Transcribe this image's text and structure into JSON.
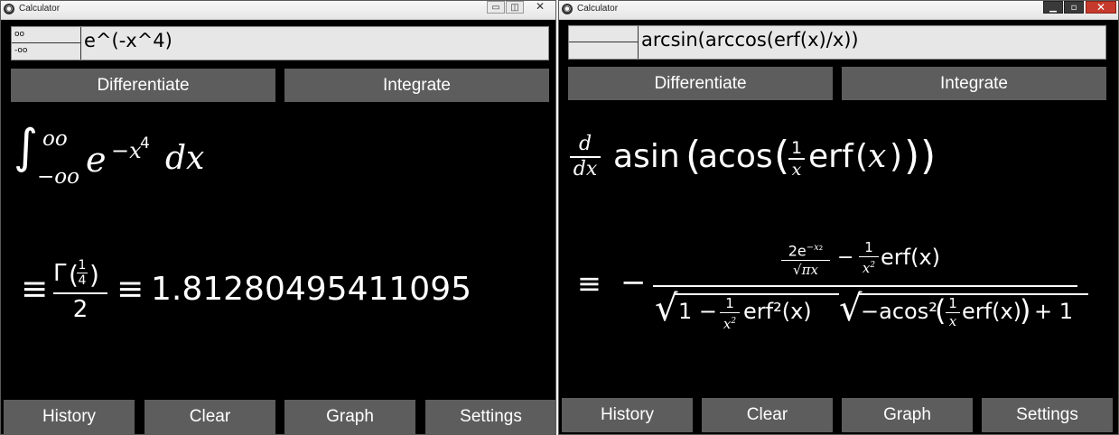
{
  "windows": [
    {
      "title": "Calculator",
      "bounds": {
        "upper": "oo",
        "lower": "-oo"
      },
      "expression": "e^(-x^4)",
      "actions": {
        "differentiate": "Differentiate",
        "integrate": "Integrate"
      },
      "result": {
        "int_upper": "oo",
        "int_lower": "−oo",
        "base": "e",
        "exp": "−x",
        "exp_power": "4",
        "dx": "dx",
        "equiv": "≡",
        "gamma": "Γ",
        "gamma_num": "1",
        "gamma_den": "4",
        "den": "2",
        "numeric": "1.81280495411095"
      },
      "footer": {
        "history": "History",
        "clear": "Clear",
        "graph": "Graph",
        "settings": "Settings"
      }
    },
    {
      "title": "Calculator",
      "bounds": {
        "upper": "",
        "lower": ""
      },
      "expression": "arcsin(arccos(erf(x)/x))",
      "actions": {
        "differentiate": "Differentiate",
        "integrate": "Integrate"
      },
      "result": {
        "d": "d",
        "dx": "dx",
        "asin": "asin",
        "acos": "acos",
        "one": "1",
        "x": "x",
        "erf": "erf",
        "erfx": "erf(x)",
        "equiv": "≡",
        "minus": "−",
        "two_e": "2e",
        "neg_x2": "−x",
        "sq": "2",
        "sqrt_pi_x": "√πx",
        "one_minus": "1 −",
        "erf2x": "erf²(x)",
        "neg_acos2": "−acos²",
        "plus_one": "+ 1"
      },
      "footer": {
        "history": "History",
        "clear": "Clear",
        "graph": "Graph",
        "settings": "Settings"
      }
    }
  ]
}
